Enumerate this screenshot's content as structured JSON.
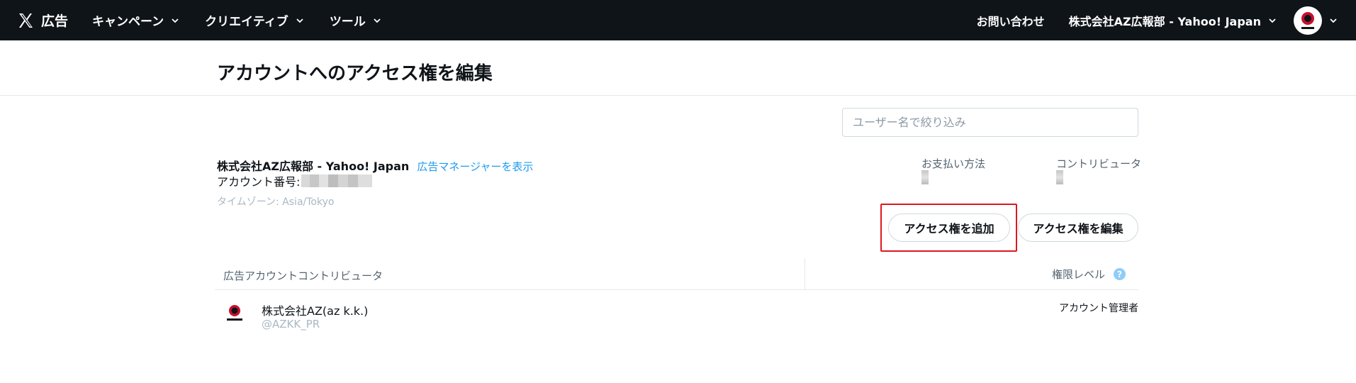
{
  "nav": {
    "brand_label": "広告",
    "menu": [
      {
        "label": "キャンペーン"
      },
      {
        "label": "クリエイティブ"
      },
      {
        "label": "ツール"
      }
    ],
    "contact_label": "お問い合わせ",
    "account_label": "株式会社AZ広報部 - Yahoo! Japan"
  },
  "page": {
    "title": "アカウントへのアクセス権を編集"
  },
  "filter": {
    "placeholder": "ユーザー名で絞り込み",
    "value": ""
  },
  "account": {
    "name": "株式会社AZ広報部 - Yahoo! Japan",
    "link_label": "広告マネージャーを表示",
    "number_label": "アカウント番号:",
    "timezone": "タイムゾーン: Asia/Tokyo",
    "payment_label": "お支払い方法",
    "contributor_label": "コントリビュータ"
  },
  "actions": {
    "add_access": "アクセス権を追加",
    "edit_access": "アクセス権を編集"
  },
  "table": {
    "col_contributor": "広告アカウントコントリビュータ",
    "col_level": "権限レベル",
    "help_glyph": "?",
    "rows": [
      {
        "name": "株式会社AZ(az k.k.)",
        "handle": "@AZKK_PR",
        "role": "アカウント管理者"
      }
    ]
  },
  "colors": {
    "nav_bg": "#0f1419",
    "link": "#1d9bf0",
    "highlight": "#e0161f",
    "help_icon": "#8ecdf7"
  }
}
